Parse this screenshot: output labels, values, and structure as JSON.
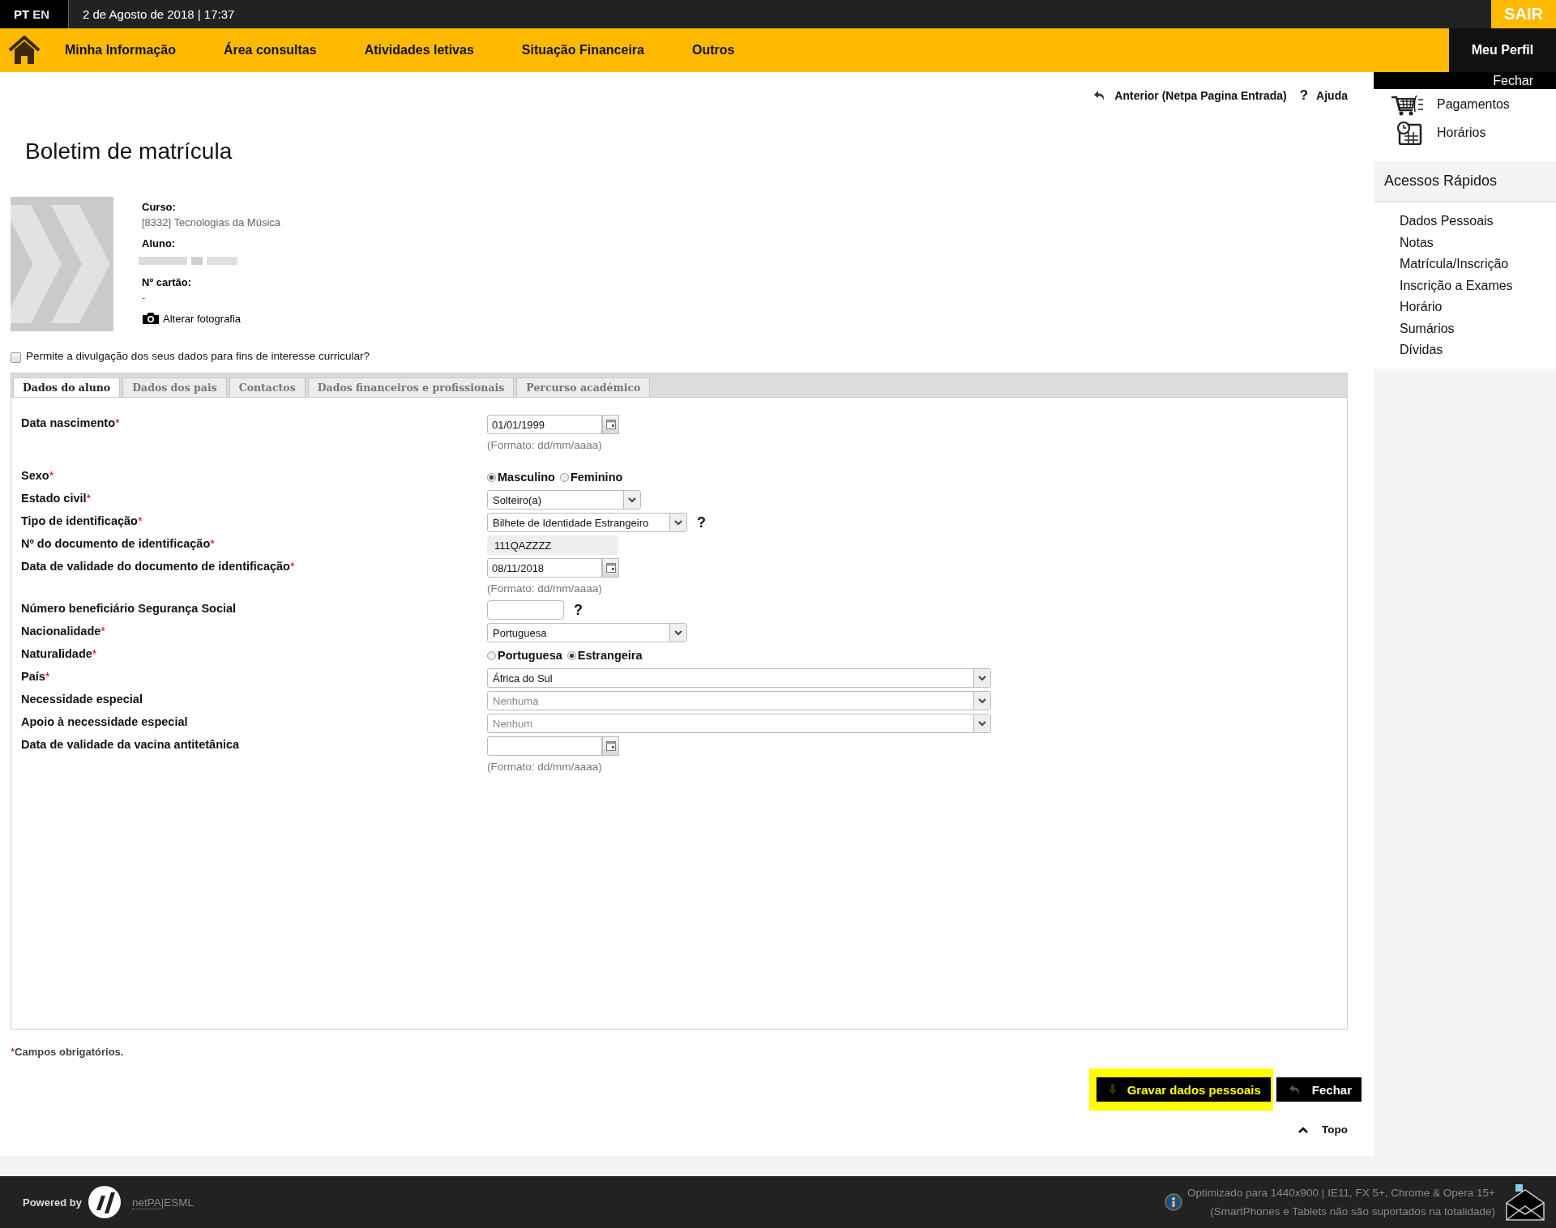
{
  "top_bar": {
    "languages": [
      {
        "label": "PT",
        "selected": true
      },
      {
        "label": "EN",
        "selected": false
      }
    ],
    "datetime": "2 de Agosto de 2018 | 17:37",
    "logout": "SAIR"
  },
  "nav": {
    "items": [
      "Minha Informação",
      "Área consultas",
      "Atividades letivas",
      "Situação Financeira",
      "Outros"
    ],
    "profile": "Meu Perfil"
  },
  "actions": [
    {
      "kind": "back",
      "label": "Anterior (Netpa Pagina Entrada)"
    },
    {
      "kind": "help",
      "glyph": "?",
      "label": "Ajuda"
    }
  ],
  "title": "Boletim de matrícula",
  "profile": {
    "fields": [
      {
        "label": "Curso:",
        "value": "[8332] Tecnologias da Música"
      },
      {
        "label": "Aluno:",
        "redacted": true
      },
      {
        "label": "Nº cartão:",
        "value": "-"
      }
    ],
    "change_photo": "Alterar fotografia"
  },
  "consent": {
    "label": "Permite a divulgação dos seus dados para fins de interesse curricular?",
    "checked": false
  },
  "tabs": [
    {
      "label": "Dados do aluno",
      "selected": true
    },
    {
      "label": "Dados dos pais",
      "selected": false
    },
    {
      "label": "Contactos",
      "selected": false
    },
    {
      "label": "Dados financeiros e profissionais",
      "selected": false
    },
    {
      "label": "Percurso académico",
      "selected": false
    }
  ],
  "form": [
    {
      "kind": "date",
      "label": "Data nascimento",
      "mark": "*",
      "value": "01/01/1999",
      "hint": "(Formato: dd/mm/aaaa)"
    },
    {
      "kind": "radio",
      "label": "Sexo",
      "mark": "*",
      "options": [
        {
          "label": "Masculino",
          "selected": true
        },
        {
          "label": "Feminino",
          "selected": false
        }
      ]
    },
    {
      "kind": "select",
      "label": "Estado civil",
      "mark": "*",
      "value": "Solteiro(a)",
      "disabled": false
    },
    {
      "kind": "select",
      "label": "Tipo de identificação",
      "mark": "*",
      "value": "Bilhete de Identidade Estrangeiro",
      "help": "?",
      "disabled": false
    },
    {
      "kind": "readonly",
      "label": "Nº do documento de identificação",
      "mark": "*",
      "value": "111QAZZZZ"
    },
    {
      "kind": "date",
      "label": "Data de validade do documento de identificação",
      "mark": "*",
      "value": "08/11/2018",
      "hint": "(Formato: dd/mm/aaaa)"
    },
    {
      "kind": "text",
      "label": "Número beneficiário Segurança Social",
      "help": "?"
    },
    {
      "kind": "select",
      "label": "Nacionalidade",
      "mark": "*",
      "value": "Portuguesa",
      "disabled": false
    },
    {
      "kind": "radio",
      "label": "Naturalidade",
      "mark": "*",
      "options": [
        {
          "label": "Portuguesa",
          "selected": false
        },
        {
          "label": "Estrangeira",
          "selected": true
        }
      ]
    },
    {
      "kind": "select",
      "label": "País",
      "mark": "*",
      "value": "África do Sul",
      "disabled": false
    },
    {
      "kind": "select",
      "label": "Necessidade especial",
      "value": "Nenhuma",
      "disabled": true
    },
    {
      "kind": "select",
      "label": "Apoio à necessidade especial",
      "value": "Nenhum",
      "disabled": true
    },
    {
      "kind": "date",
      "label": "Data de validade da vacina antitetânica",
      "hint": "(Formato: dd/mm/aaaa)"
    }
  ],
  "note": {
    "mark": "*",
    "text": "Campos obrigatórios."
  },
  "buttons": [
    {
      "kind": "save",
      "label": "Gravar dados pessoais",
      "highlighted": true
    },
    {
      "kind": "close",
      "label": "Fechar",
      "highlighted": false
    }
  ],
  "back_to_top": "Topo",
  "sidebar": {
    "close": "Fechar",
    "shortcuts": [
      {
        "kind": "cart",
        "label": "Pagamentos"
      },
      {
        "kind": "calendar",
        "label": "Horários"
      }
    ],
    "quick_title": "Acessos Rápidos",
    "quick_links": [
      "Dados Pessoais",
      "Notas",
      "Matrícula/Inscrição",
      "Inscrição a Exames",
      "Horário",
      "Sumários",
      "Dívidas"
    ]
  },
  "footer": {
    "powered": "Powered by",
    "link": "netPA",
    "suffix": "|ESML",
    "notice": [
      "Optimizado para 1440x900 | IE11, FX 5+, Chrome & Opera 15+",
      "(SmartPhones e Tablets não são suportados na totalidade)"
    ]
  }
}
